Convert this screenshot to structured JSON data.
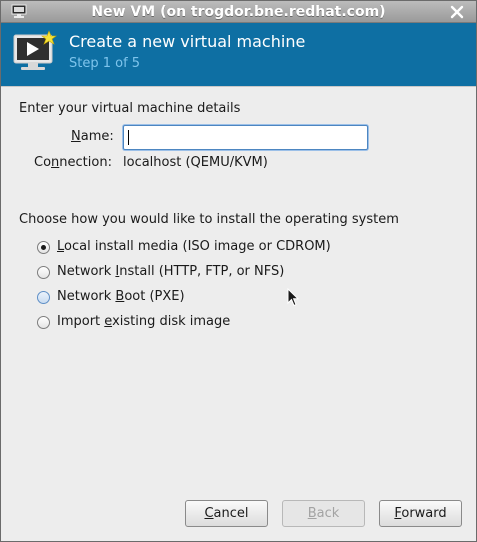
{
  "window": {
    "title": "New VM (on trogdor.bne.redhat.com)"
  },
  "header": {
    "title": "Create a new virtual machine",
    "step": "Step 1 of 5"
  },
  "details": {
    "section_label": "Enter your virtual machine details",
    "name_label_mnemonic": "N",
    "name_label_rest": "ame:",
    "name_value": "",
    "connection_label_pre": "Co",
    "connection_label_mnemonic": "n",
    "connection_label_post": "nection:",
    "connection_value": "localhost (QEMU/KVM)"
  },
  "install": {
    "section_label": "Choose how you would like to install the operating system",
    "options": [
      {
        "pre": "",
        "mnemonic": "L",
        "post": "ocal install media (ISO image or CDROM)",
        "checked": true
      },
      {
        "pre": "Network ",
        "mnemonic": "I",
        "post": "nstall (HTTP, FTP, or NFS)",
        "checked": false
      },
      {
        "pre": "Network ",
        "mnemonic": "B",
        "post": "oot (PXE)",
        "checked": false
      },
      {
        "pre": "Import ",
        "mnemonic": "e",
        "post": "xisting disk image",
        "checked": false
      }
    ]
  },
  "buttons": {
    "cancel_mnemonic": "C",
    "cancel_rest": "ancel",
    "back_mnemonic": "B",
    "back_rest": "ack",
    "forward_mnemonic": "F",
    "forward_rest": "orward"
  },
  "colors": {
    "header_bg": "#0e6fa3",
    "step_text": "#7ec4ec"
  },
  "icons": {
    "titlebar": "monitor-icon",
    "close": "close-icon",
    "header": "new-vm-icon"
  }
}
